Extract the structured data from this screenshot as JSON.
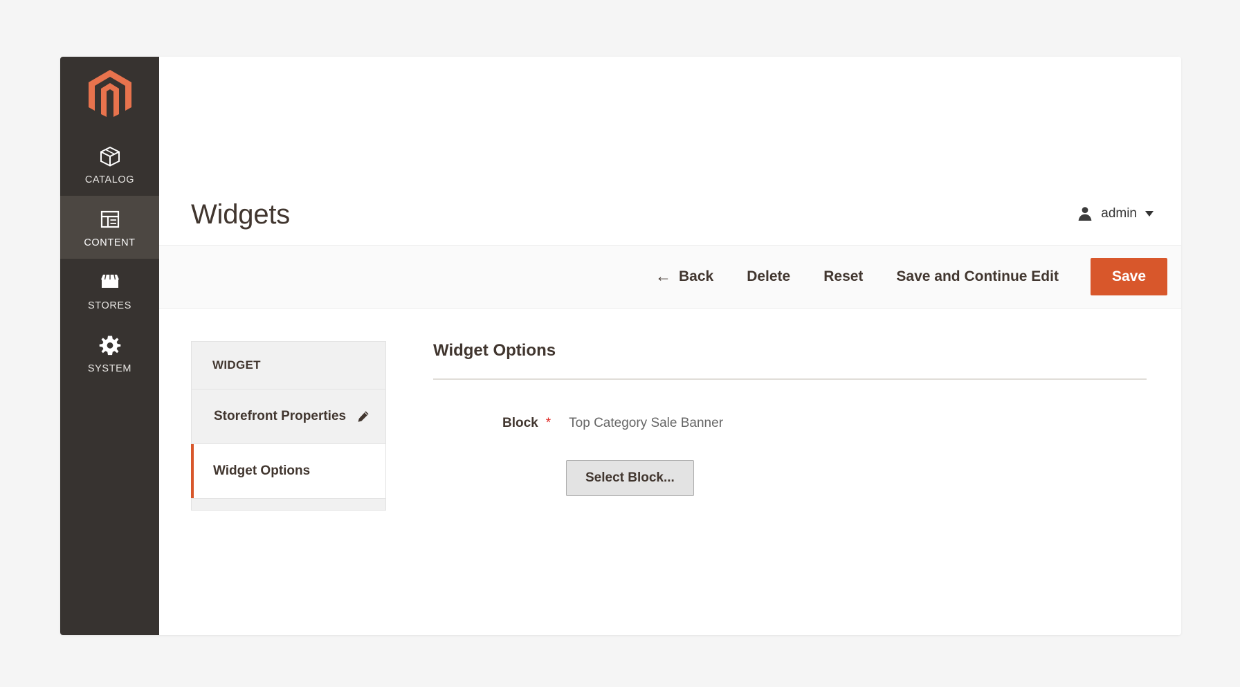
{
  "sidebar": {
    "logo": "magento-logo",
    "items": [
      {
        "label": "CATALOG",
        "icon": "box-icon",
        "active": false
      },
      {
        "label": "CONTENT",
        "icon": "layout-icon",
        "active": true
      },
      {
        "label": "STORES",
        "icon": "storefront-icon",
        "active": false
      },
      {
        "label": "SYSTEM",
        "icon": "gear-icon",
        "active": false
      }
    ]
  },
  "header": {
    "title": "Widgets",
    "admin": {
      "name": "admin",
      "icon": "user-icon",
      "caret": "chevron-down-icon"
    }
  },
  "toolbar": {
    "back_label": "Back",
    "back_arrow": "←",
    "delete_label": "Delete",
    "reset_label": "Reset",
    "save_continue_label": "Save and Continue Edit",
    "save_label": "Save",
    "save_color": "#d8572b"
  },
  "tabs": {
    "group_title": "WIDGET",
    "items": [
      {
        "label": "Storefront Properties",
        "icon": "pencil-icon",
        "active": false
      },
      {
        "label": "Widget Options",
        "icon": "",
        "active": true
      }
    ],
    "accent_color": "#d8572b"
  },
  "options": {
    "title": "Widget Options",
    "fields": [
      {
        "label": "Block",
        "required_marker": "*",
        "value": "Top Category Sale Banner"
      }
    ],
    "select_block_label": "Select Block..."
  }
}
